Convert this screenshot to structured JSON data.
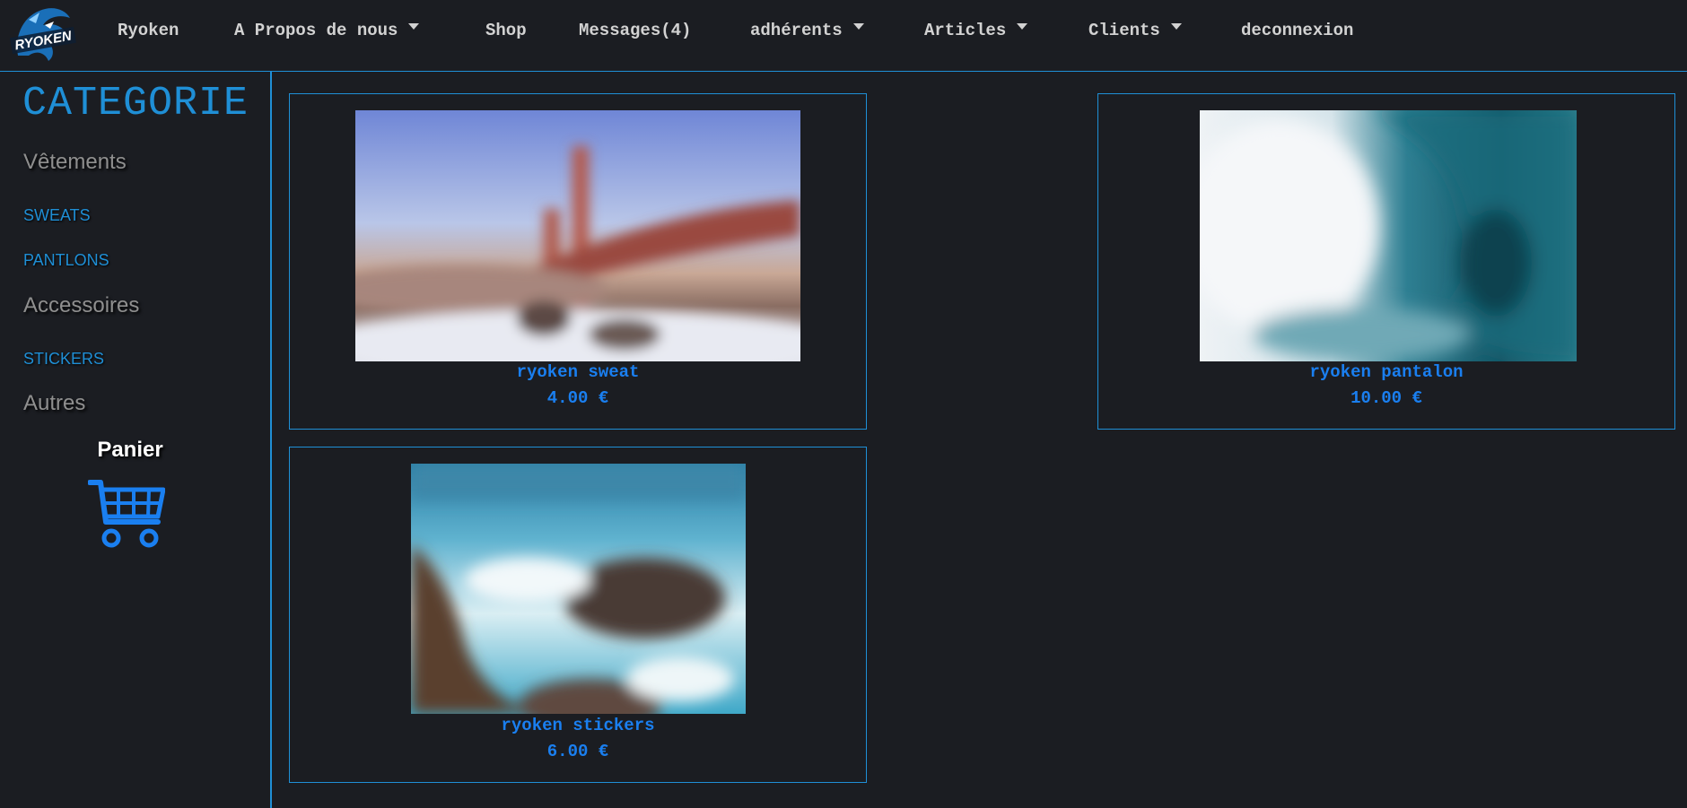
{
  "nav": {
    "logo_text": "RYOKEN",
    "items": [
      {
        "label": "Ryoken",
        "dropdown": false
      },
      {
        "label": "A Propos de nous",
        "dropdown": true
      },
      {
        "label": "Shop",
        "dropdown": false
      },
      {
        "label": "Messages(4)",
        "dropdown": false
      },
      {
        "label": "adhérents",
        "dropdown": true
      },
      {
        "label": "Articles",
        "dropdown": true
      },
      {
        "label": "Clients",
        "dropdown": true
      },
      {
        "label": "deconnexion",
        "dropdown": false
      }
    ]
  },
  "sidebar": {
    "title": "CATEGORIE",
    "sections": [
      {
        "title": "Vêtements",
        "links": [
          "SWEATS",
          "PANTLONS"
        ]
      },
      {
        "title": "Accessoires",
        "links": [
          "STICKERS"
        ]
      },
      {
        "title": "Autres",
        "links": []
      }
    ],
    "cart_label": "Panier"
  },
  "products": [
    {
      "name": "ryoken sweat",
      "price": "4.00 €",
      "image": "blurred-bridge-photo"
    },
    {
      "name": "ryoken pantalon",
      "price": "10.00 €",
      "image": "blurred-wave-photo"
    },
    {
      "name": "ryoken stickers",
      "price": "6.00 €",
      "image": "blurred-coast-photo"
    }
  ],
  "colors": {
    "background": "#1b1d22",
    "accent": "#1f8fd6",
    "price_blue": "#1a7ff0",
    "nav_text": "#d2d2d2"
  }
}
